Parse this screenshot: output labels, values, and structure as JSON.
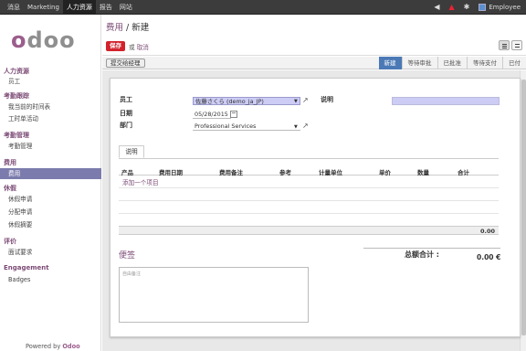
{
  "topbar": {
    "menu": [
      "消息",
      "Marketing",
      "人力资源",
      "报告",
      "网站"
    ],
    "active_index": 2,
    "user": "Employee",
    "icons": [
      "volume-icon",
      "alert-icon",
      "settings-icon"
    ]
  },
  "sidebar": {
    "logo": "odoo",
    "sections": [
      {
        "title": "人力资源",
        "items": [
          "员工"
        ]
      },
      {
        "title": "考勤跟踪",
        "items": [
          "我当前的时间表",
          "工时单活动"
        ]
      },
      {
        "title": "考勤管理",
        "items": [
          "考勤管理"
        ]
      },
      {
        "title": "费用",
        "items": [
          "费用"
        ]
      },
      {
        "title": "休假",
        "items": [
          "休假申请",
          "分配申请",
          "休假摘要"
        ]
      },
      {
        "title": "评价",
        "items": [
          "面试要求"
        ]
      },
      {
        "title": "Engagement",
        "items": [
          "Badges"
        ]
      }
    ],
    "active_item": "费用",
    "powered_prefix": "Powered by ",
    "powered_brand": "Odoo"
  },
  "header": {
    "breadcrumb_parent": "费用",
    "breadcrumb_sep": " / ",
    "breadcrumb_current": "新建",
    "save_label": "保存",
    "or_label": "或",
    "cancel_label": "取消"
  },
  "statusbar": {
    "submit_label": "提交给经理",
    "stages": [
      "新建",
      "等待审批",
      "已批准",
      "等待支付",
      "已付"
    ],
    "active_stage": "新建"
  },
  "form": {
    "employee_label": "员工",
    "employee_value": "佐藤さくら (demo_ja_JP)",
    "date_label": "日期",
    "date_value": "05/28/2015",
    "department_label": "部门",
    "department_value": "Professional Services",
    "description_label": "说明",
    "description_value": ""
  },
  "tab": {
    "label": "说明"
  },
  "lines_table": {
    "columns": [
      "产品",
      "费用日期",
      "费用备注",
      "参考",
      "计量单位",
      "单价",
      "数量",
      "合计"
    ],
    "add_line_label": "添加一个项目",
    "total": "0.00"
  },
  "notes": {
    "title": "便签",
    "placeholder": "自由备注"
  },
  "totals": {
    "label": "总额合计 :",
    "value": "0.00 €"
  }
}
